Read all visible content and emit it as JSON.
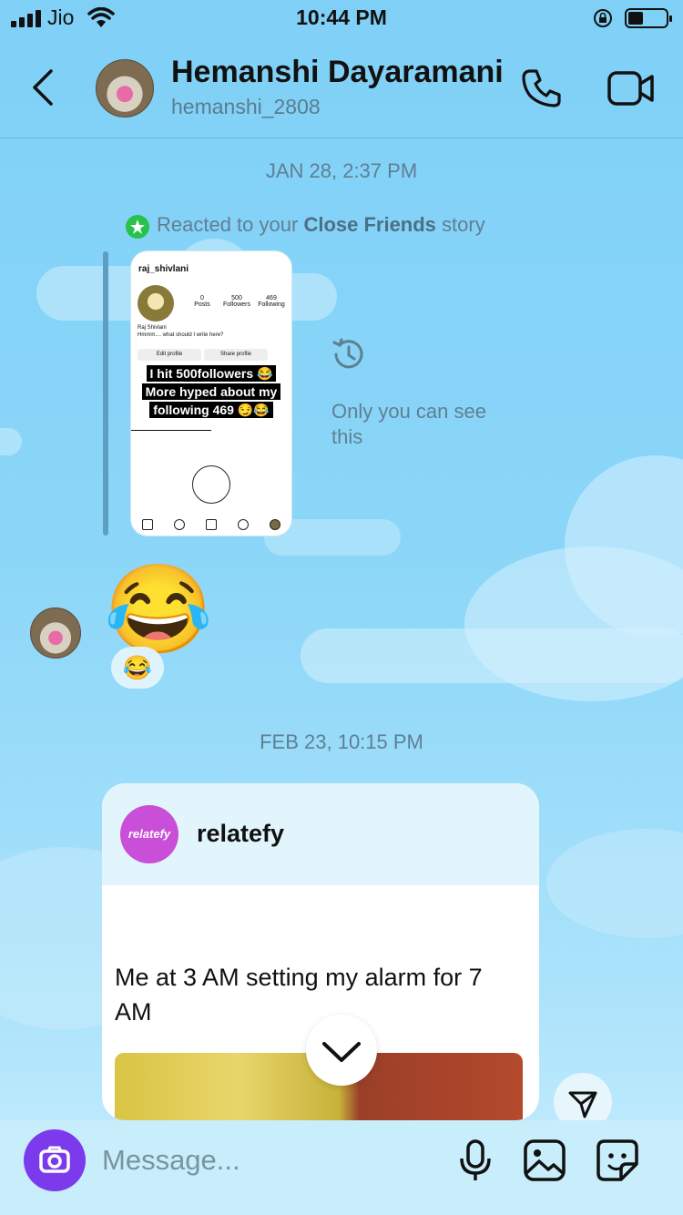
{
  "status_bar": {
    "carrier": "Jio",
    "time": "10:44 PM"
  },
  "header": {
    "name": "Hemanshi Dayaramani",
    "username": "hemanshi_2808"
  },
  "thread": {
    "timestamp_1": "JAN 28, 2:37 PM",
    "story_reply": {
      "prefix": "Reacted to your ",
      "highlight": "Close Friends",
      "suffix": " story",
      "private_note": "Only you can see this",
      "preview": {
        "username": "raj_shivlani",
        "stats": [
          {
            "value": "0",
            "label": "Posts"
          },
          {
            "value": "500",
            "label": "Followers"
          },
          {
            "value": "469",
            "label": "Following"
          }
        ],
        "display_name": "Raj Shivlani",
        "bio": "Hmmm.... what should I write here?",
        "edit_button": "Edit profile",
        "share_button": "Share profile",
        "caption_lines": [
          "I hit 500followers 😂",
          "More hyped about my",
          "following 469 😏😂"
        ]
      }
    },
    "emoji_message": "😂",
    "reaction": "😂",
    "timestamp_2": "FEB 23, 10:15 PM",
    "shared_post": {
      "account": "relatefy",
      "avatar_text": "relatefy",
      "text": "Me at 3 AM setting my alarm for 7 AM"
    }
  },
  "composer": {
    "placeholder": "Message..."
  }
}
